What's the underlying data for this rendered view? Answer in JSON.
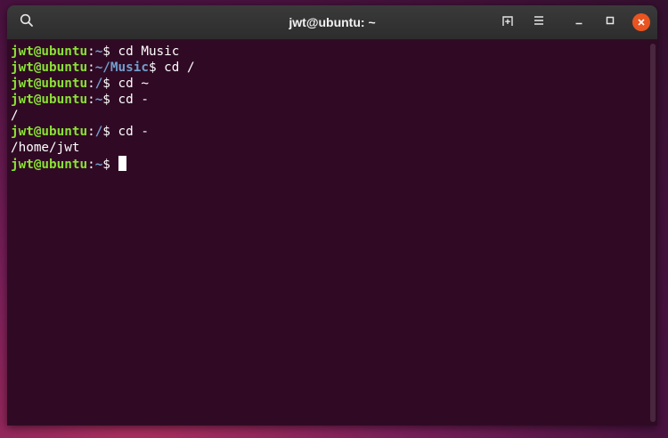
{
  "window": {
    "title": "jwt@ubuntu: ~",
    "buttons": {
      "search_icon": "search-icon",
      "new_tab_icon": "new-tab-icon",
      "menu_icon": "hamburger-menu-icon",
      "minimize_icon": "minimize-icon",
      "maximize_icon": "maximize-icon",
      "close_icon": "close-icon"
    }
  },
  "colors": {
    "terminal_bg": "#300a24",
    "user_host": "#8ae234",
    "path": "#729fcf",
    "text": "#ffffff",
    "close_button": "#e95420"
  },
  "terminal": {
    "lines": [
      {
        "user": "jwt@ubuntu",
        "sep": ":",
        "path": "~",
        "prompt": "$ ",
        "cmd": "cd Music"
      },
      {
        "user": "jwt@ubuntu",
        "sep": ":",
        "path": "~/Music",
        "prompt": "$ ",
        "cmd": "cd /"
      },
      {
        "user": "jwt@ubuntu",
        "sep": ":",
        "path": "/",
        "prompt": "$ ",
        "cmd": "cd ~"
      },
      {
        "user": "jwt@ubuntu",
        "sep": ":",
        "path": "~",
        "prompt": "$ ",
        "cmd": "cd -"
      },
      {
        "output": "/"
      },
      {
        "user": "jwt@ubuntu",
        "sep": ":",
        "path": "/",
        "prompt": "$ ",
        "cmd": "cd -"
      },
      {
        "output": "/home/jwt"
      },
      {
        "user": "jwt@ubuntu",
        "sep": ":",
        "path": "~",
        "prompt": "$ ",
        "cmd": ""
      }
    ]
  }
}
